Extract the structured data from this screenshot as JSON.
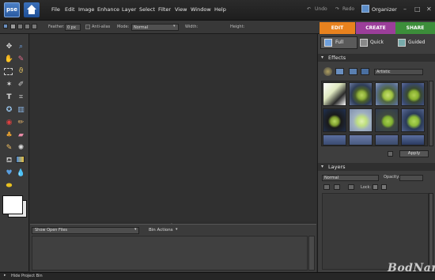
{
  "app": {
    "logo_text": "pse"
  },
  "menu": [
    "File",
    "Edit",
    "Image",
    "Enhance",
    "Layer",
    "Select",
    "Filter",
    "View",
    "Window",
    "Help"
  ],
  "topbar": {
    "undo": "Undo",
    "redo": "Redo",
    "organizer": "Organizer",
    "minimize": "–",
    "maximize": "□",
    "close": "✕"
  },
  "options": {
    "feather_label": "Feather:",
    "feather_value": "0 px",
    "antialias": "Anti-alias",
    "mode_label": "Mode:",
    "mode_value": "Normal",
    "width_label": "Width:",
    "height_label": "Height:"
  },
  "tabs": [
    {
      "label": "EDIT",
      "color": "#e8821e"
    },
    {
      "label": "CREATE",
      "color": "#9b3e9a"
    },
    {
      "label": "SHARE",
      "color": "#3c8e3a"
    }
  ],
  "modes": [
    "Full",
    "Quick",
    "Guided"
  ],
  "effects": {
    "title": "Effects",
    "category": "Artistic",
    "apply": "Apply"
  },
  "layers": {
    "title": "Layers",
    "blend_mode": "Normal",
    "opacity_label": "Opacity:",
    "lock_label": "Lock:"
  },
  "bin": {
    "show": "Show Open Files",
    "actions": "Bin Actions",
    "hide": "Hide Project Bin"
  },
  "watermark": "BodNara",
  "colors": {
    "foreground": "#ffffff",
    "background": "#e6e6e6"
  }
}
